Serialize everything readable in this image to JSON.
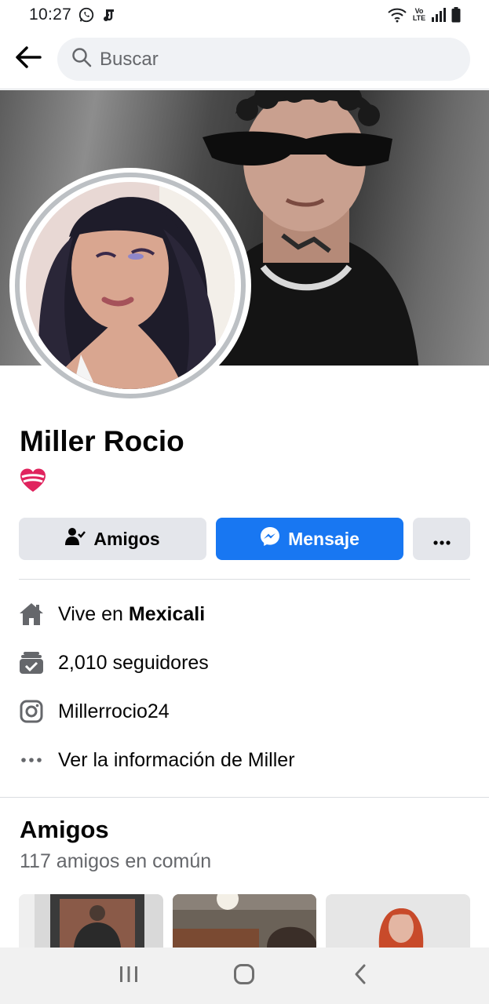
{
  "status_bar": {
    "time": "10:27",
    "network_label": "Vo LTE"
  },
  "search": {
    "placeholder": "Buscar"
  },
  "profile": {
    "name": "Miller Rocio",
    "bio_emoji": "heart-emoji"
  },
  "actions": {
    "friends_label": "Amigos",
    "message_label": "Mensaje"
  },
  "details": {
    "lives_prefix": "Vive en ",
    "lives_city": "Mexicali",
    "followers": "2,010 seguidores",
    "instagram": "Millerrocio24",
    "more_info": "Ver la información de Miller"
  },
  "friends_section": {
    "title": "Amigos",
    "mutual": "117 amigos en común"
  },
  "colors": {
    "accent": "#1877f2",
    "secondary_button": "#e4e6eb",
    "muted_text": "#65676b"
  }
}
